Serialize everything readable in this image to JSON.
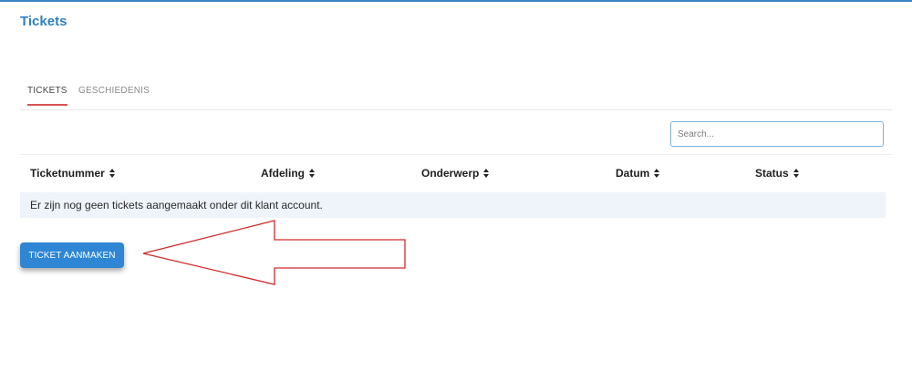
{
  "page": {
    "title": "Tickets"
  },
  "tabs": [
    {
      "label": "TICKETS",
      "active": true
    },
    {
      "label": "GESCHIEDENIS",
      "active": false
    }
  ],
  "search": {
    "placeholder": "Search...",
    "value": ""
  },
  "table": {
    "columns": [
      "Ticketnummer",
      "Afdeling",
      "Onderwerp",
      "Datum",
      "Status"
    ],
    "empty_message": "Er zijn nog geen tickets aangemaakt onder dit klant account."
  },
  "actions": {
    "create_ticket_label": "TICKET AANMAKEN"
  },
  "colors": {
    "accent": "#2e86d4",
    "title": "#2f7fc1",
    "active_tab_underline": "#d9534f",
    "annotation_arrow": "#d42a2a"
  }
}
